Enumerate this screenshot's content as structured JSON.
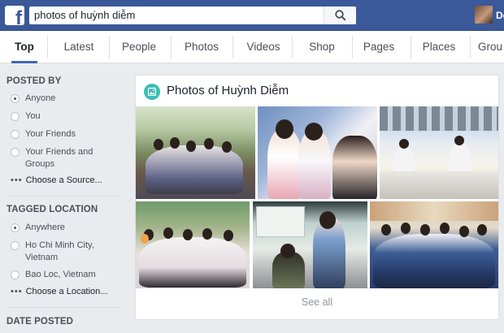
{
  "header": {
    "search_value": "photos of huỳnh diễm",
    "user_name": "Do",
    "brand_color": "#3b5998"
  },
  "tabs": [
    {
      "label": "Top",
      "active": true
    },
    {
      "label": "Latest"
    },
    {
      "label": "People"
    },
    {
      "label": "Photos"
    },
    {
      "label": "Videos"
    },
    {
      "label": "Shop"
    },
    {
      "label": "Pages"
    },
    {
      "label": "Places"
    },
    {
      "label": "Grou"
    }
  ],
  "sidebar": {
    "posted_by": {
      "title": "POSTED BY",
      "options": [
        "Anyone",
        "You",
        "Your Friends",
        "Your Friends and Groups"
      ],
      "selected": 0,
      "choose": "Choose a Source..."
    },
    "tagged_location": {
      "title": "TAGGED LOCATION",
      "options": [
        "Anywhere",
        "Ho Chi Minh City, Vietnam",
        "Bao Loc, Vietnam"
      ],
      "selected": 0,
      "choose": "Choose a Location..."
    },
    "date_posted": {
      "title": "DATE POSTED"
    }
  },
  "results": {
    "title": "Photos of Huỳnh Diễm",
    "see_all": "See all",
    "icon": "photo-icon",
    "icon_color": "#3fbdb5"
  }
}
